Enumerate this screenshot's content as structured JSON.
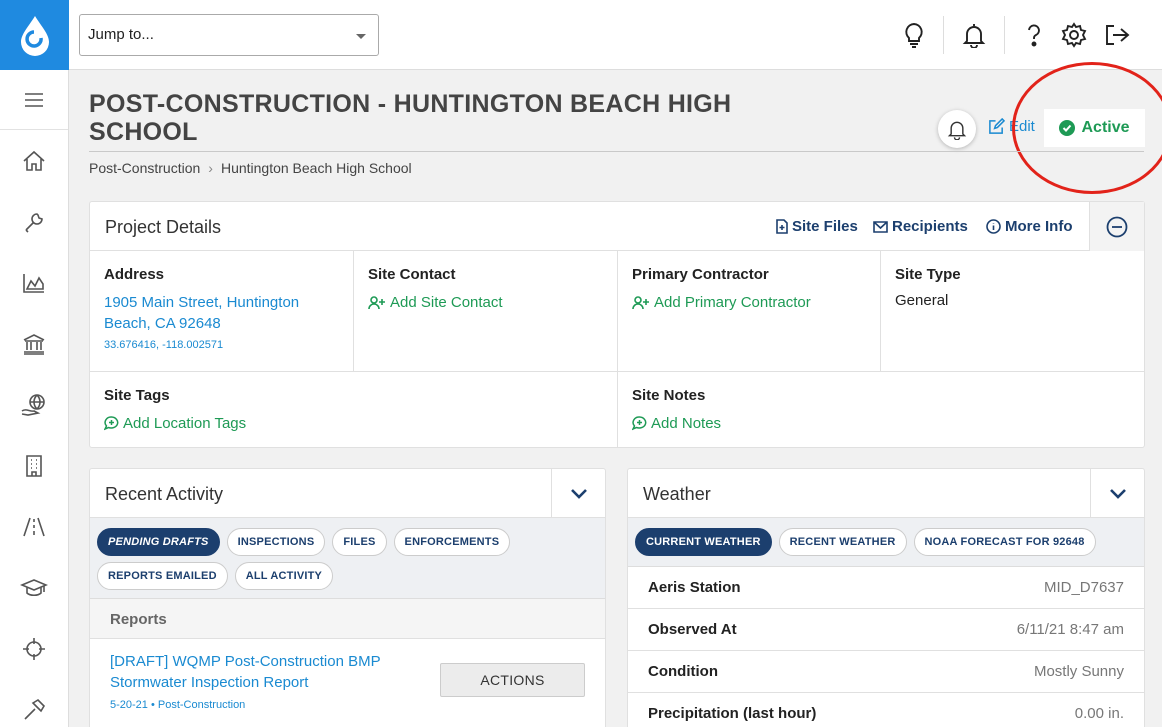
{
  "topbar": {
    "jump_placeholder": "Jump to..."
  },
  "header": {
    "title": "POST-CONSTRUCTION - HUNTINGTON BEACH HIGH SCHOOL",
    "edit_label": "Edit",
    "status": "Active",
    "breadcrumb": [
      "Post-Construction",
      "Huntington Beach High School"
    ]
  },
  "sidebar": {
    "icons": [
      "menu-icon",
      "home-icon",
      "wrench-icon",
      "chart-icon",
      "institution-icon",
      "globe-hand-icon",
      "building-icon",
      "road-icon",
      "graduation-cap-icon",
      "crosshairs-icon",
      "hammer-icon"
    ]
  },
  "project_details": {
    "title": "Project Details",
    "links": [
      "Site Files",
      "Recipients",
      "More Info"
    ],
    "address": {
      "label": "Address",
      "line1": "1905 Main Street, Huntington",
      "line2": "Beach, CA 92648",
      "coords": "33.676416, -118.002571"
    },
    "site_contact": {
      "label": "Site Contact",
      "action": "Add Site Contact"
    },
    "primary_contractor": {
      "label": "Primary Contractor",
      "action": "Add Primary Contractor"
    },
    "site_type": {
      "label": "Site Type",
      "value": "General"
    },
    "site_tags": {
      "label": "Site Tags",
      "action": "Add Location Tags"
    },
    "site_notes": {
      "label": "Site Notes",
      "action": "Add Notes"
    }
  },
  "recent_activity": {
    "title": "Recent Activity",
    "tabs": [
      "PENDING DRAFTS",
      "INSPECTIONS",
      "FILES",
      "ENFORCEMENTS",
      "REPORTS EMAILED",
      "ALL ACTIVITY"
    ],
    "active_tab": "PENDING DRAFTS",
    "reports_label": "Reports",
    "report": {
      "title": "[DRAFT] WQMP Post-Construction BMP Stormwater Inspection Report",
      "meta": "5-20-21 • Post-Construction",
      "action": "ACTIONS"
    }
  },
  "weather": {
    "title": "Weather",
    "tabs": [
      "CURRENT WEATHER",
      "RECENT WEATHER",
      "NOAA FORECAST FOR 92648"
    ],
    "active_tab": "CURRENT WEATHER",
    "rows": [
      {
        "label": "Aeris Station",
        "value": "MID_D7637"
      },
      {
        "label": "Observed At",
        "value": "6/11/21 8:47 am"
      },
      {
        "label": "Condition",
        "value": "Mostly Sunny"
      },
      {
        "label": "Precipitation (last hour)",
        "value": "0.00 in."
      }
    ]
  },
  "colors": {
    "brand": "#1f8ae0",
    "navy": "#1c3f6e",
    "link": "#1a8ad1",
    "green": "#1e9a55",
    "annotation": "#e2231a"
  }
}
